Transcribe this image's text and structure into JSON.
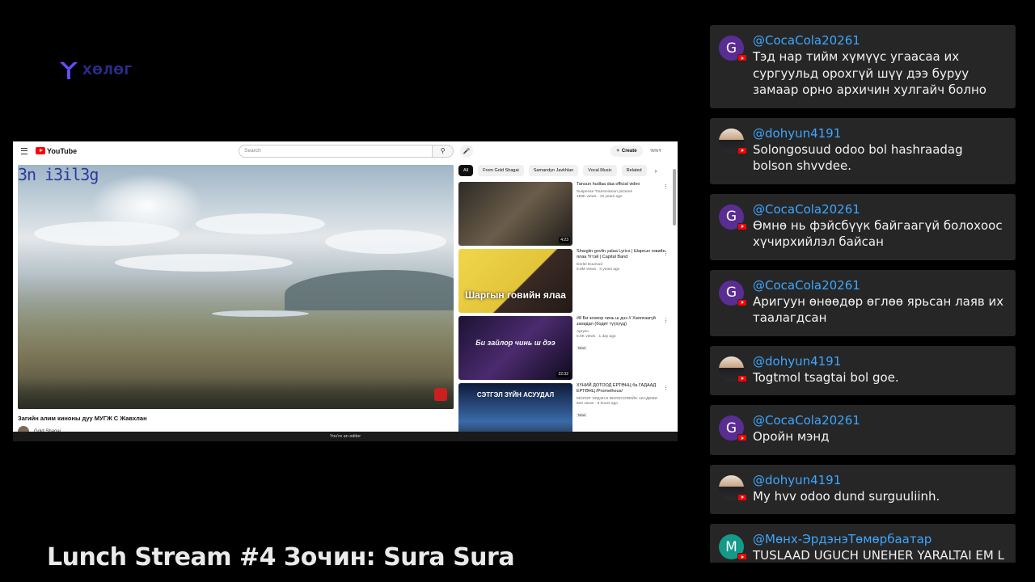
{
  "logo": {
    "text": "ХӨЛӨГ"
  },
  "stream": {
    "title": "Lunch Stream #4 Зочин: Sura Sura"
  },
  "youtube": {
    "brand": "YouTube",
    "search_placeholder": "Search",
    "create_label": "Create",
    "user_label": "%%Y",
    "player_caption": "3n i3il3g",
    "video_title": "Загийн алим киноны дуу МУГЖ С Жавхлан",
    "channel_name": "Gold Shagai",
    "footer": "You're an editor",
    "chips": [
      "All",
      "From Gold Shagai",
      "Samandyn Javkhlan",
      "Vocal Music",
      "Related"
    ],
    "recommendations": [
      {
        "title": "Tanuun hudlaa daa official video",
        "channel": "Suspense Transmission pictures",
        "views": "459K views · 15 years ago",
        "duration": "4:23",
        "thumb_text": ""
      },
      {
        "title": "Shargiin govlin yalaa Lyrics | Шаргын говийн ялаа Үгтэй | Capital Band",
        "channel": "Dorlei Duurvud",
        "views": "6.8M views · 4 years ago",
        "duration": "",
        "thumb_text": "Шаргын говийн ялаа"
      },
      {
        "title": "#8 Би зохиор чинь ш дээ // Хаялгаагүй захидал (бодит түүхүүд)",
        "channel": "Apryso",
        "views": "5.6K views · 1 day ago",
        "duration": "22:32",
        "thumb_text": "Би зайлор чинь ш дээ",
        "badge": "New"
      },
      {
        "title": "ХҮНИЙ ДОТООД ЕРТӨНЦ ба ГАДААД ЕРТӨНЦ /Prometheus/",
        "channel": "МОЛОР ЭРДЭНЭ ФИЛОСОФИЙН АКАДЕМИ",
        "views": "822 views · 5 hours ago",
        "duration": "",
        "thumb_text": "СЭТГЭЛ ЗҮЙН АСУУДАЛ",
        "badge": "New"
      }
    ]
  },
  "chat": {
    "messages": [
      {
        "user": "@CocaCola20261",
        "text": "Тэд нар тийм хүмүүс угаасаа их сургуульд орохгүй шүү дээ буруу замаар орно архичин хулгайч болно",
        "avatar_letter": "G",
        "avatar_style": "purple"
      },
      {
        "user": "@dohyun4191",
        "text": "Solongosuud odoo bol hashraadag bolson shvvdee.",
        "avatar_letter": "",
        "avatar_style": "photo"
      },
      {
        "user": "@CocaCola20261",
        "text": "Өмнө нь фэйсбүүк байгаагүй болохоос хүчирхийлэл байсан",
        "avatar_letter": "G",
        "avatar_style": "purple"
      },
      {
        "user": "@CocaCola20261",
        "text": "Аригуун өнөөдөр өглөө ярьсан лаяв их таалагдсан",
        "avatar_letter": "G",
        "avatar_style": "purple"
      },
      {
        "user": "@dohyun4191",
        "text": "Togtmol tsagtai bol goe.",
        "avatar_letter": "",
        "avatar_style": "photo"
      },
      {
        "user": "@CocaCola20261",
        "text": "Оройн мэнд",
        "avatar_letter": "G",
        "avatar_style": "purple"
      },
      {
        "user": "@dohyun4191",
        "text": "My hvv odoo dund surguuliinh.",
        "avatar_letter": "",
        "avatar_style": "photo"
      },
      {
        "user": "@Мөнх-ЭрдэнэТөмөрбаатар",
        "text": "TUSLAAD UGUCH UNEHER YARALTAI EM L",
        "avatar_letter": "M",
        "avatar_style": "teal"
      }
    ]
  },
  "colors": {
    "chat_username": "#3ea6ff",
    "chat_bg": "#262626",
    "youtube_red": "#ff0000"
  }
}
